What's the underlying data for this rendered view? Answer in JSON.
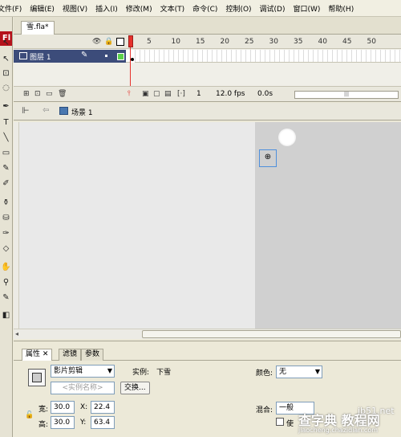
{
  "menu": [
    "文件(F)",
    "编辑(E)",
    "视图(V)",
    "插入(I)",
    "修改(M)",
    "文本(T)",
    "命令(C)",
    "控制(O)",
    "调试(D)",
    "窗口(W)",
    "帮助(H)"
  ],
  "tools": {
    "badge": "Fl",
    "icons": [
      {
        "name": "selection-tool-icon",
        "glyph": "↖"
      },
      {
        "name": "subselection-tool-icon",
        "glyph": "↖"
      },
      {
        "name": "free-transform-tool-icon",
        "glyph": "⊡"
      },
      {
        "name": "lasso-tool-icon",
        "glyph": "◌"
      },
      {
        "name": "pen-tool-icon",
        "glyph": "✒"
      },
      {
        "name": "text-tool-icon",
        "glyph": "T"
      },
      {
        "name": "line-tool-icon",
        "glyph": "╲"
      },
      {
        "name": "rectangle-tool-icon",
        "glyph": "▭"
      },
      {
        "name": "pencil-tool-icon",
        "glyph": "✎"
      },
      {
        "name": "brush-tool-icon",
        "glyph": "✐"
      },
      {
        "name": "ink-bottle-tool-icon",
        "glyph": "⚱"
      },
      {
        "name": "paint-bucket-tool-icon",
        "glyph": "⛁"
      },
      {
        "name": "eyedropper-tool-icon",
        "glyph": "✑"
      },
      {
        "name": "eraser-tool-icon",
        "glyph": "◇"
      },
      {
        "name": "hand-tool-icon",
        "glyph": "✋"
      },
      {
        "name": "zoom-tool-icon",
        "glyph": "⚲"
      },
      {
        "name": "stroke-color-icon",
        "glyph": "✎"
      },
      {
        "name": "fill-color-icon",
        "glyph": "◧"
      }
    ]
  },
  "document": {
    "tab": "雪.fla*"
  },
  "timeline": {
    "ruler": [
      "5",
      "10",
      "15",
      "20",
      "25",
      "30",
      "35",
      "40",
      "45",
      "50"
    ],
    "layer": "图层 1",
    "status": {
      "frame": "1",
      "fps": "12.0 fps",
      "time": "0.0s"
    }
  },
  "editbar": {
    "scene": "场景 1"
  },
  "properties": {
    "tabs": [
      "属性",
      "滤镜",
      "参数"
    ],
    "symbol_type": "影片剪辑",
    "instance_label": "实例:",
    "instance_value": "下雪",
    "instance_name_placeholder": "<实例名称>",
    "swap_button": "交换...",
    "color_label": "颜色:",
    "color_value": "无",
    "width_label": "宽:",
    "width": "30.0",
    "height_label": "高:",
    "height": "30.0",
    "x_label": "X:",
    "x": "22.4",
    "y_label": "Y:",
    "y": "63.4",
    "blend_label": "混合:",
    "blend_value": "一般",
    "cache_label": "使"
  },
  "watermark": {
    "top": "jb51.net",
    "main": "查字典 教程网",
    "url": "jiaocheng.chazidian.com"
  }
}
